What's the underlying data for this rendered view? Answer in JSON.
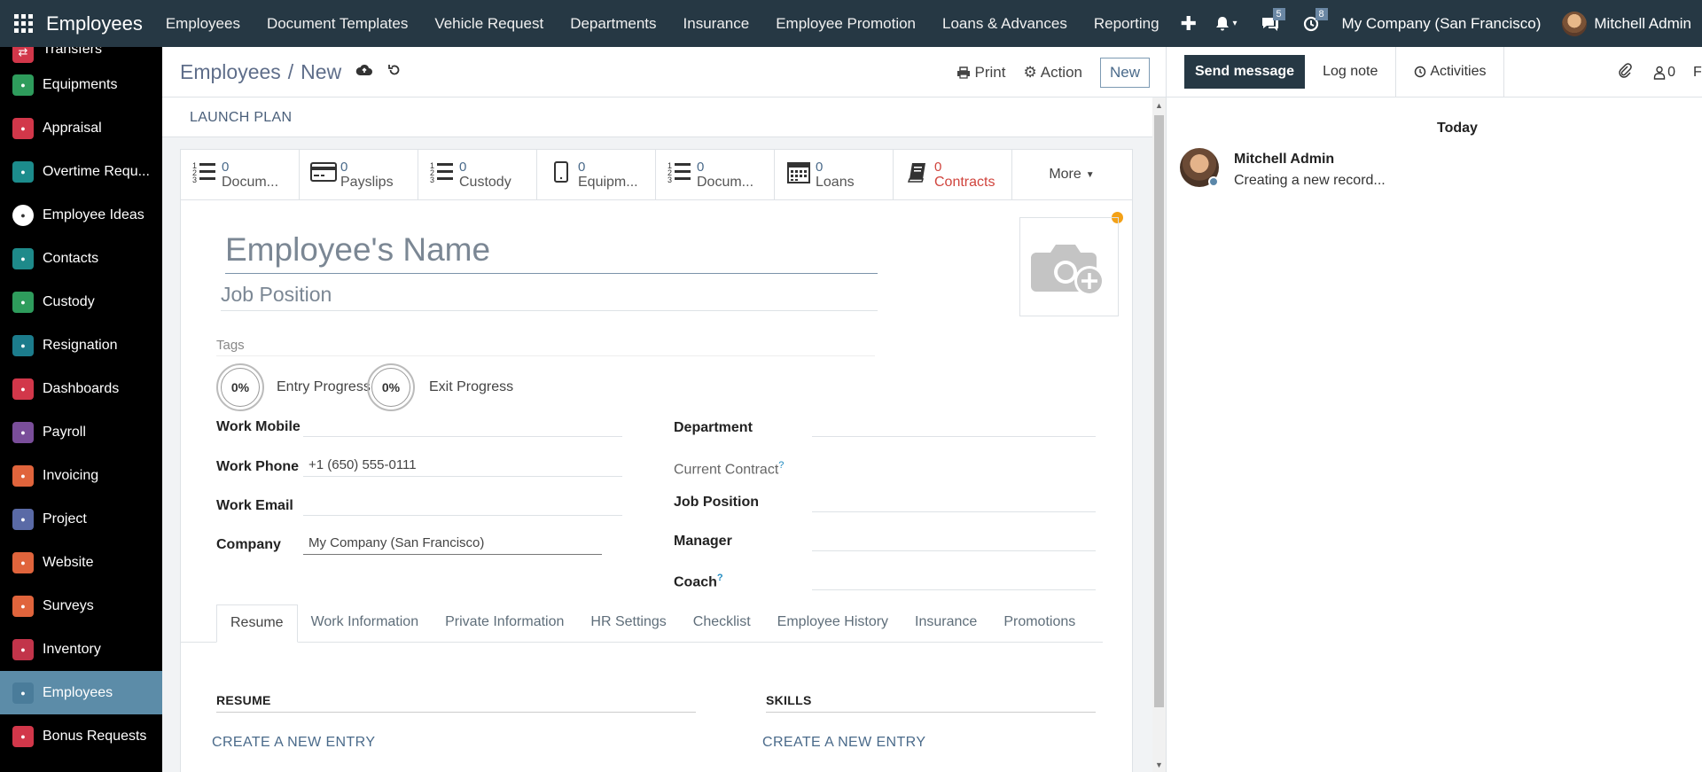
{
  "topbar": {
    "brand": "Employees",
    "menu": [
      "Employees",
      "Document Templates",
      "Vehicle Request",
      "Departments",
      "Insurance",
      "Employee Promotion",
      "Loans & Advances",
      "Reporting"
    ],
    "messages_count": "5",
    "activities_count": "8",
    "company": "My Company (San Francisco)",
    "user": "Mitchell Admin"
  },
  "sidebar": {
    "partial_item": "Transfers",
    "items": [
      {
        "label": "Equipments",
        "icon": "equipments-icon",
        "color": "#2e9c5c"
      },
      {
        "label": "Appraisal",
        "icon": "appraisal-icon",
        "color": "#d2374a"
      },
      {
        "label": "Overtime Requ...",
        "icon": "overtime-icon",
        "color": "#1c8c8c"
      },
      {
        "label": "Employee Ideas",
        "icon": "ideas-icon",
        "color": "#ffffff"
      },
      {
        "label": "Contacts",
        "icon": "contacts-icon",
        "color": "#1e8a8a"
      },
      {
        "label": "Custody",
        "icon": "custody-icon",
        "color": "#2e9c5c"
      },
      {
        "label": "Resignation",
        "icon": "resignation-icon",
        "color": "#1c7c8c"
      },
      {
        "label": "Dashboards",
        "icon": "dashboards-icon",
        "color": "#d2374a"
      },
      {
        "label": "Payroll",
        "icon": "payroll-icon",
        "color": "#7a4e9a"
      },
      {
        "label": "Invoicing",
        "icon": "invoicing-icon",
        "color": "#e0643c"
      },
      {
        "label": "Project",
        "icon": "project-icon",
        "color": "#5a6aa6"
      },
      {
        "label": "Website",
        "icon": "website-icon",
        "color": "#e0643c"
      },
      {
        "label": "Surveys",
        "icon": "surveys-icon",
        "color": "#e0643c"
      },
      {
        "label": "Inventory",
        "icon": "inventory-icon",
        "color": "#c2344a"
      },
      {
        "label": "Employees",
        "icon": "employees-icon",
        "color": "#4a7c9a",
        "active": true
      },
      {
        "label": "Bonus Requests",
        "icon": "bonus-icon",
        "color": "#d2374a"
      }
    ]
  },
  "control": {
    "breadcrumb_root": "Employees",
    "breadcrumb_sep": "/",
    "breadcrumb_current": "New",
    "print_label": "Print",
    "action_label": "Action",
    "new_label": "New"
  },
  "statusbar": {
    "launch_plan": "LAUNCH PLAN"
  },
  "smart_buttons": [
    {
      "value": "0",
      "label": "Docum...",
      "icon": "list-icon",
      "red": false
    },
    {
      "value": "0",
      "label": "Payslips",
      "icon": "payslips-icon",
      "red": false
    },
    {
      "value": "0",
      "label": "Custody",
      "icon": "list-icon",
      "red": false
    },
    {
      "value": "0",
      "label": "Equipm...",
      "icon": "tablet-icon",
      "red": false
    },
    {
      "value": "0",
      "label": "Docum...",
      "icon": "list-icon",
      "red": false
    },
    {
      "value": "0",
      "label": "Loans",
      "icon": "calendar-icon",
      "red": false
    },
    {
      "value": "0",
      "label": "Contracts",
      "icon": "book-icon",
      "red": true
    }
  ],
  "more_label": "More",
  "form": {
    "name_placeholder": "Employee's Name",
    "job_placeholder": "Job Position",
    "tags_label": "Tags",
    "entry_progress_value": "0%",
    "entry_progress_label": "Entry Progress",
    "exit_progress_value": "0%",
    "exit_progress_label": "Exit Progress",
    "work_mobile_label": "Work Mobile",
    "work_phone_label": "Work Phone",
    "work_phone_value": "+1 (650) 555-0111",
    "work_email_label": "Work Email",
    "company_label": "Company",
    "company_value": "My Company (San Francisco)",
    "department_label": "Department",
    "current_contract_label": "Current Contract",
    "job_position_label": "Job Position",
    "manager_label": "Manager",
    "coach_label": "Coach",
    "help_mark": "?"
  },
  "tabs": [
    "Resume",
    "Work Information",
    "Private Information",
    "HR Settings",
    "Checklist",
    "Employee History",
    "Insurance",
    "Promotions"
  ],
  "resume": {
    "resume_title": "RESUME",
    "skills_title": "SKILLS",
    "create_entry": "CREATE A NEW ENTRY"
  },
  "chatter": {
    "send_message": "Send message",
    "log_note": "Log note",
    "activities": "Activities",
    "followers_count": "0",
    "follow_partial": "Fo",
    "today": "Today",
    "author": "Mitchell Admin",
    "body": "Creating a new record..."
  }
}
